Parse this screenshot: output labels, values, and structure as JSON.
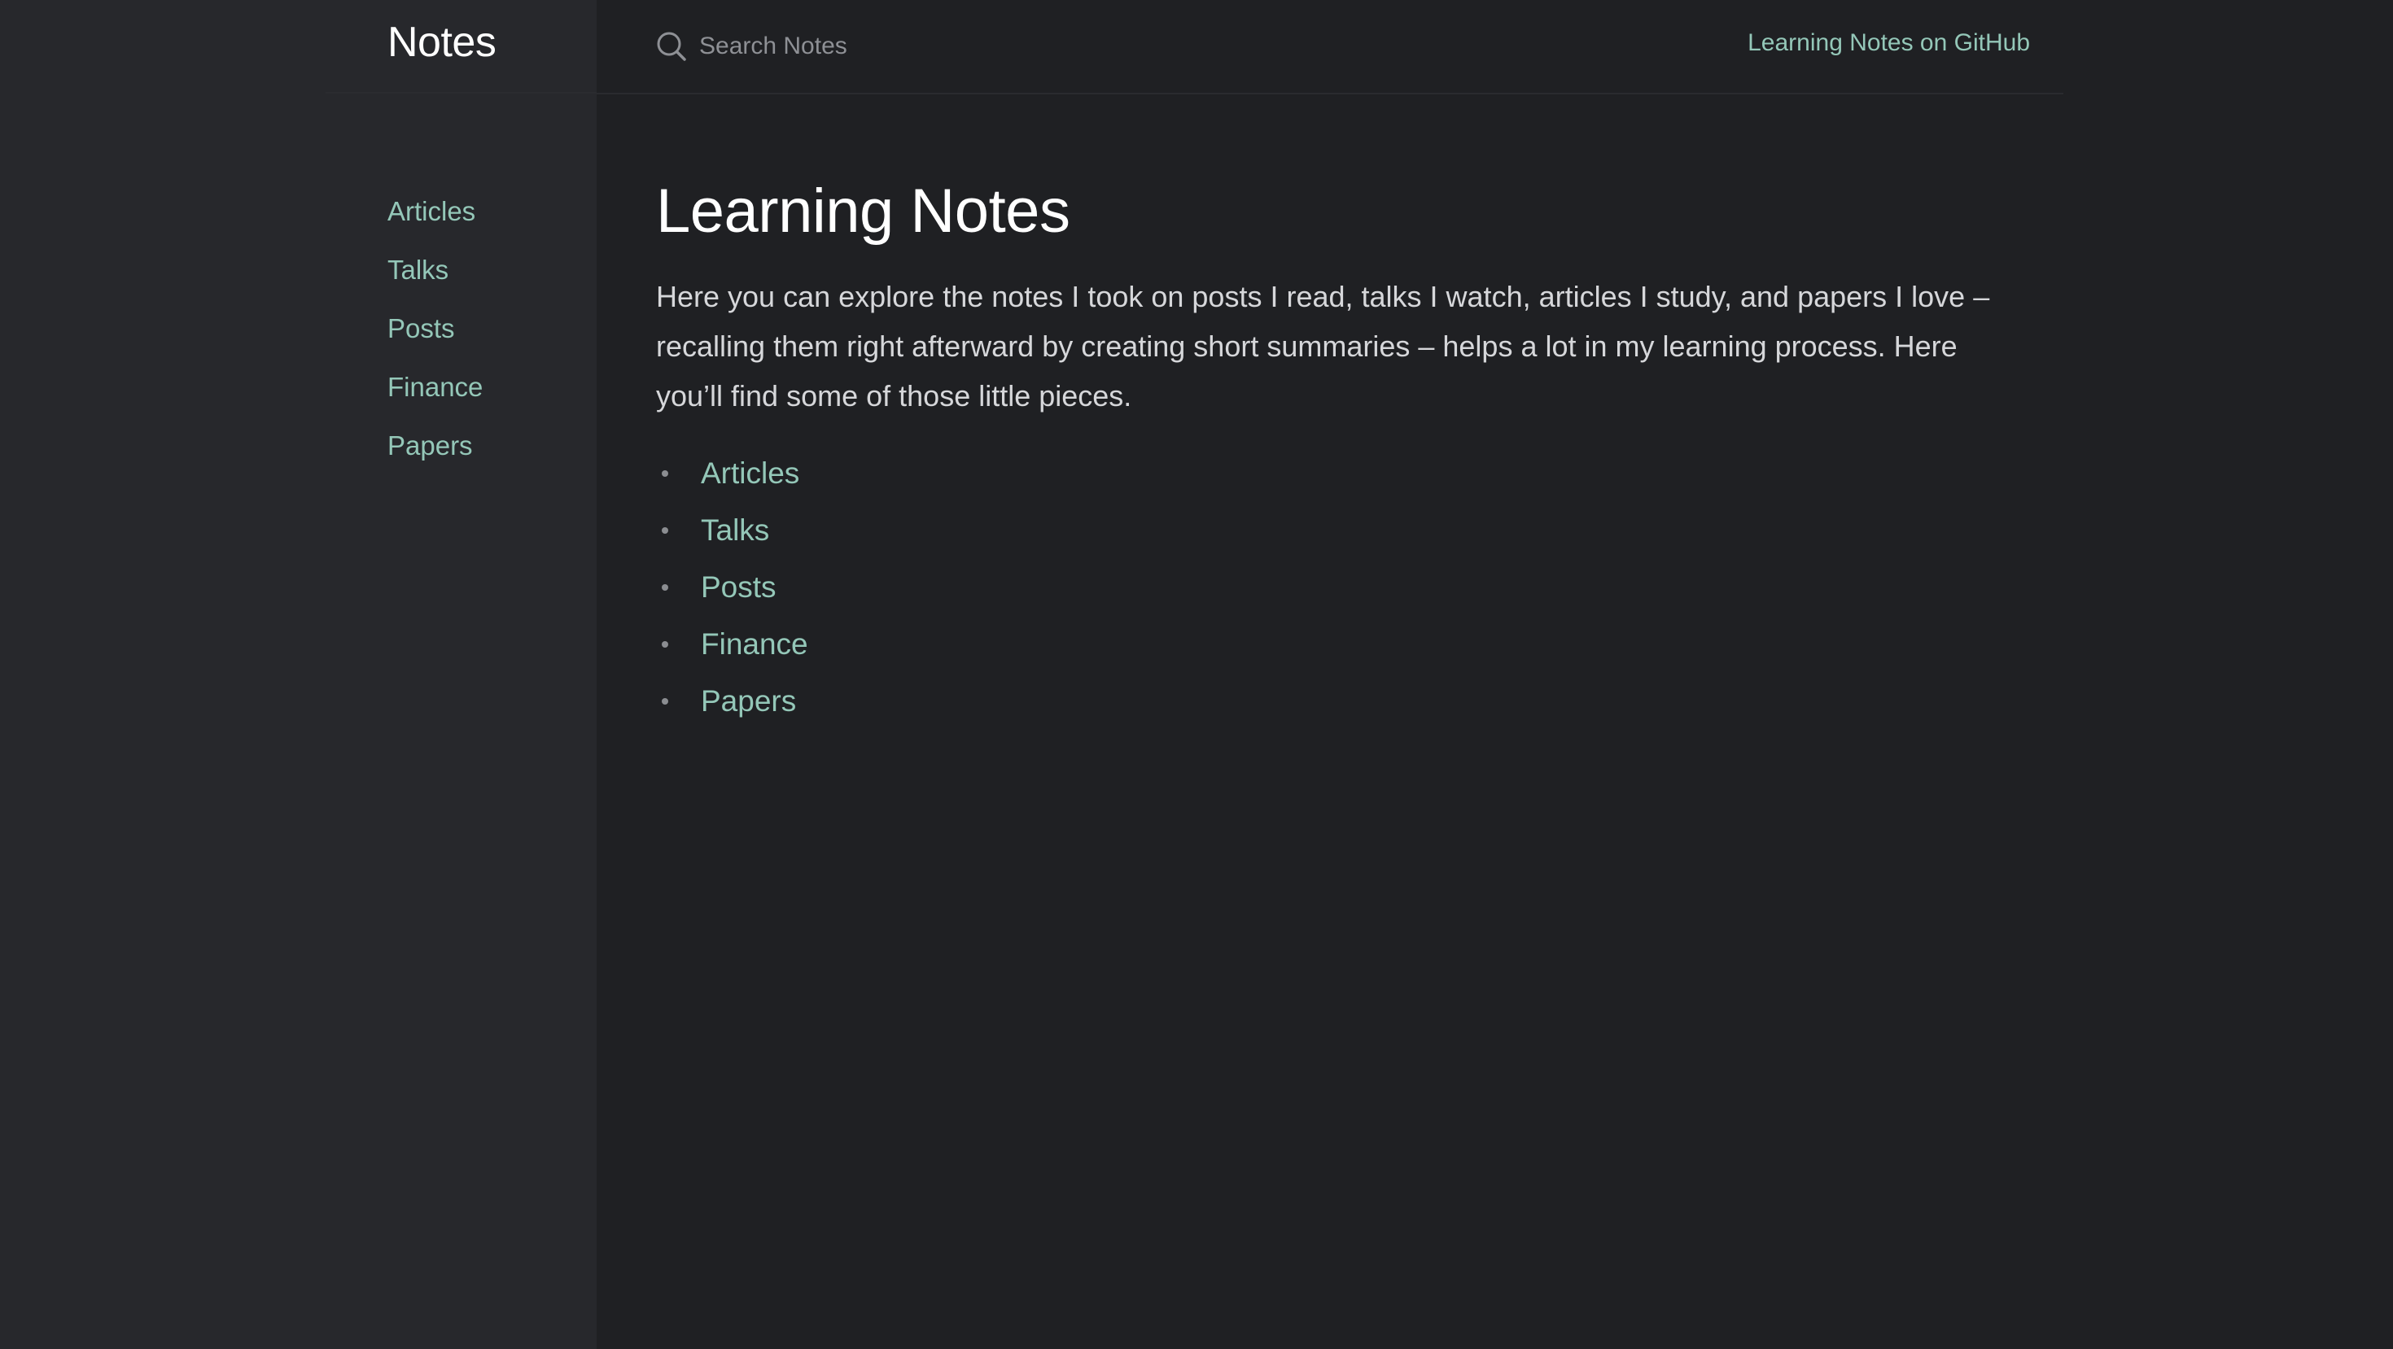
{
  "header": {
    "site_title": "Notes",
    "search_placeholder": "Search Notes",
    "github_link": "Learning Notes on GitHub"
  },
  "sidebar": {
    "items": [
      {
        "label": "Articles"
      },
      {
        "label": "Talks"
      },
      {
        "label": "Posts"
      },
      {
        "label": "Finance"
      },
      {
        "label": "Papers"
      }
    ]
  },
  "main": {
    "title": "Learning Notes",
    "intro": "Here you can explore the notes I took on posts I read, talks I watch, articles I study, and papers I love – recalling them right afterward by creating short summaries – helps a lot in my learning process. Here you’ll find some of those little pieces.",
    "links": [
      {
        "label": "Articles"
      },
      {
        "label": "Talks"
      },
      {
        "label": "Posts"
      },
      {
        "label": "Finance"
      },
      {
        "label": "Papers"
      }
    ]
  },
  "colors": {
    "background": "#1f2023",
    "sidebar_background": "#27282c",
    "link": "#94c7b8",
    "heading": "#ffffff",
    "body_text": "#d6d7da",
    "muted": "#8e9095"
  },
  "icons": {
    "search": "search-icon"
  }
}
